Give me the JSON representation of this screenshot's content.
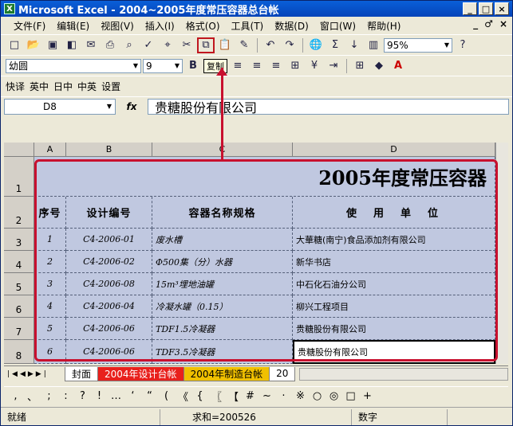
{
  "window": {
    "title": "Microsoft Excel - 2004~2005年度常压容器总台帐",
    "app_icon": "X"
  },
  "window_controls": [
    "_",
    "□",
    "×"
  ],
  "menu": [
    "文件(F)",
    "编辑(E)",
    "视图(V)",
    "插入(I)",
    "格式(O)",
    "工具(T)",
    "数据(D)",
    "窗口(W)",
    "帮助(H)"
  ],
  "mdi_controls": [
    "_",
    "♂",
    "×"
  ],
  "toolbar": {
    "zoom": "95%",
    "help_icon": "?"
  },
  "format_bar": {
    "font": "幼圆",
    "size": "9",
    "bold": "B",
    "copy_tooltip": "复制"
  },
  "translate_bar": [
    "快译",
    "英中",
    "日中",
    "中英",
    "设置"
  ],
  "formula_bar": {
    "cell_ref": "D8",
    "fx": "fx",
    "content": "贵糖股份有限公司"
  },
  "sheet": {
    "columns": [
      "A",
      "B",
      "C",
      "D"
    ],
    "rows": [
      "1",
      "2",
      "3",
      "4",
      "5",
      "6",
      "7",
      "8"
    ],
    "title": "2005年度常压容器",
    "headers": [
      "序号",
      "设计编号",
      "容器名称规格",
      "使　用　单　位"
    ],
    "data": [
      [
        "1",
        "C4-2006-01",
        "废水槽",
        "大華糖(南宁)食品添加剂有限公司"
      ],
      [
        "2",
        "C4-2006-02",
        "Φ500集（分）水器",
        "新华书店"
      ],
      [
        "3",
        "C4-2006-08",
        "15m³埋地油罐",
        "中石化石油分公司"
      ],
      [
        "4",
        "C4-2006-04",
        "冷凝水罐（0.15）",
        "柳兴工程项目"
      ],
      [
        "5",
        "C4-2006-06",
        "TDF1.5冷凝器",
        "贵糖股份有限公司"
      ],
      [
        "6",
        "C4-2006-06",
        "TDF3.5冷凝器",
        "贵糖股份有限公司"
      ]
    ]
  },
  "tabs": [
    "封面",
    "2004年设计台帐",
    "2004年制造台帐",
    "20"
  ],
  "symbols": [
    ",",
    "、",
    ";",
    ":",
    "?",
    "!",
    "…",
    "‘",
    "“",
    "(",
    "《",
    "{",
    "〖",
    "【",
    "#",
    "~",
    "·",
    "※",
    "○",
    "◎",
    "□",
    "+"
  ],
  "status": {
    "ready": "就绪",
    "sum": "求和=200526",
    "mode": "数字"
  },
  "colors": {
    "accent": "#c8102e",
    "cell_fill": "#c0c8e0",
    "titlebar": "#0a5fd8"
  }
}
